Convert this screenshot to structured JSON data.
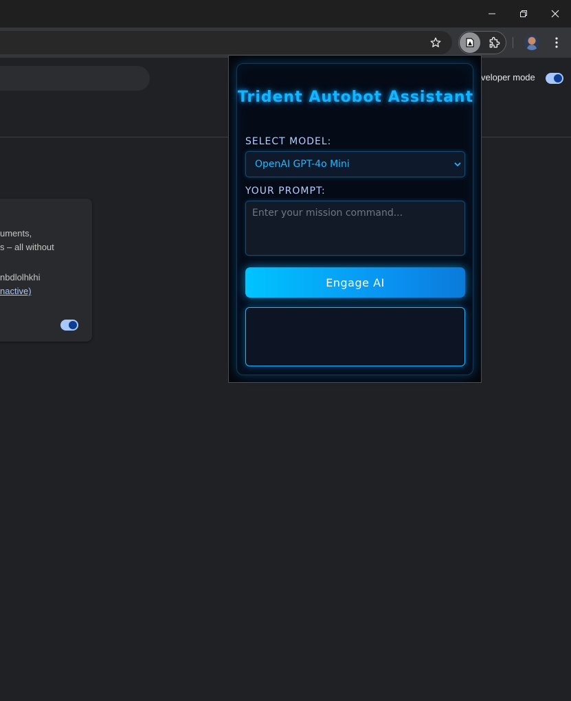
{
  "page": {
    "developer_mode_label": "veloper mode",
    "card": {
      "line1": "uments,",
      "line2": "s – all without",
      "line3": "nbdlolhkhi",
      "line4": "nactive)"
    }
  },
  "popup": {
    "title": "Trident Autobot Assistant",
    "model_label": "SELECT MODEL:",
    "model_selected": "OpenAI GPT-4o Mini",
    "prompt_label": "YOUR PROMPT:",
    "prompt_placeholder": "Enter your mission command...",
    "engage_label": "Engage AI",
    "output_text": ""
  },
  "colors": {
    "accent": "#14b4ff",
    "button_start": "#00c4ff",
    "button_end": "#0a7ad9",
    "panel_bg": "#050b16"
  },
  "icons": {
    "minimize": "minimize-icon",
    "restore": "restore-icon",
    "close": "close-icon",
    "bookmark": "star-icon",
    "extension": "extension-icon",
    "extensions_menu": "puzzle-icon",
    "profile": "avatar",
    "menu": "kebab-menu-icon"
  }
}
